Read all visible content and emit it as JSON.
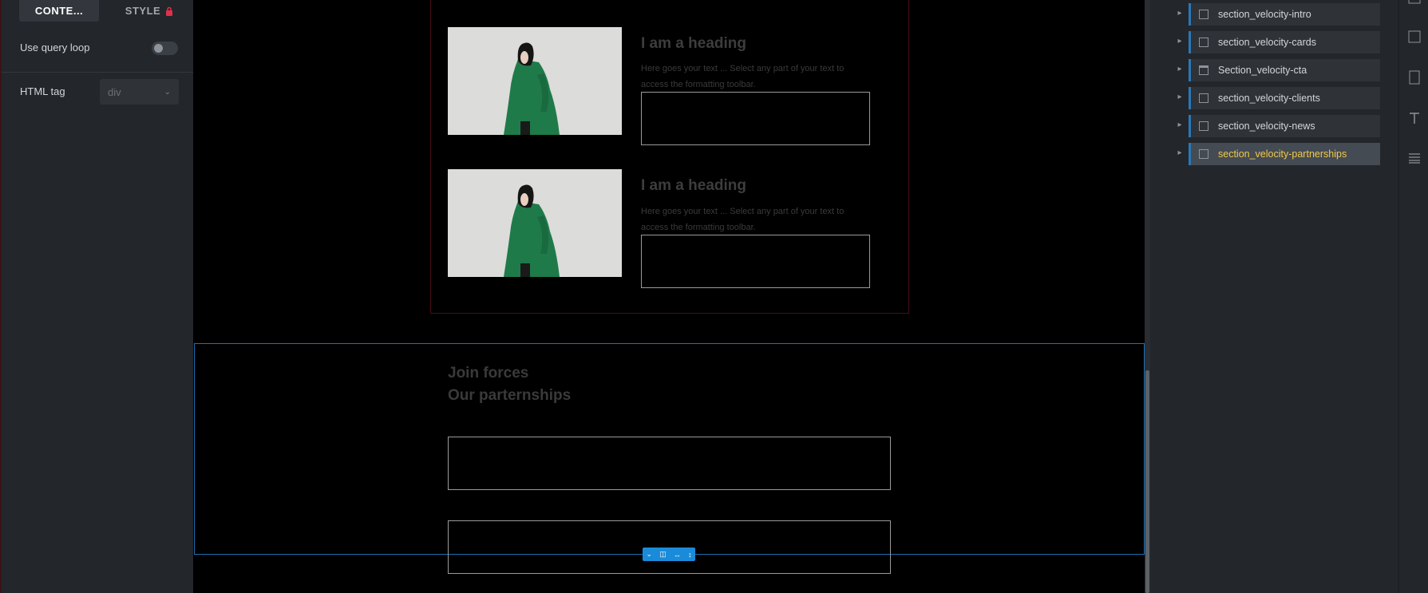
{
  "left_panel": {
    "tabs": {
      "content": "CONTE...",
      "style": "STYLE"
    },
    "query_loop_label": "Use query loop",
    "html_tag_label": "HTML tag",
    "html_tag_value": "div"
  },
  "canvas": {
    "cards": [
      {
        "heading": "I am a heading",
        "text": "Here goes your text ... Select any part of your text to access the formatting toolbar."
      },
      {
        "heading": "I am a heading",
        "text": "Here goes your text ... Select any part of your text to access the formatting toolbar."
      }
    ],
    "partnerships": {
      "line1": "Join forces",
      "line2": "Our parternships"
    }
  },
  "structure": {
    "items": [
      {
        "label": "section_velocity-intro",
        "active": false
      },
      {
        "label": "section_velocity-cards",
        "active": false
      },
      {
        "label": "Section_velocity-cta",
        "active": false
      },
      {
        "label": "section_velocity-clients",
        "active": false
      },
      {
        "label": "section_velocity-news",
        "active": false
      },
      {
        "label": "section_velocity-partnerships",
        "active": true
      }
    ]
  },
  "colors": {
    "panel_bg": "#23262a",
    "selection_blue": "#1f6fb2",
    "active_label": "#f0c94a",
    "lock_red": "#e0304a"
  },
  "icons": [
    "lock-icon",
    "chevron-down-icon",
    "chevron-right-icon",
    "box-icon",
    "text-icon",
    "list-icon"
  ]
}
